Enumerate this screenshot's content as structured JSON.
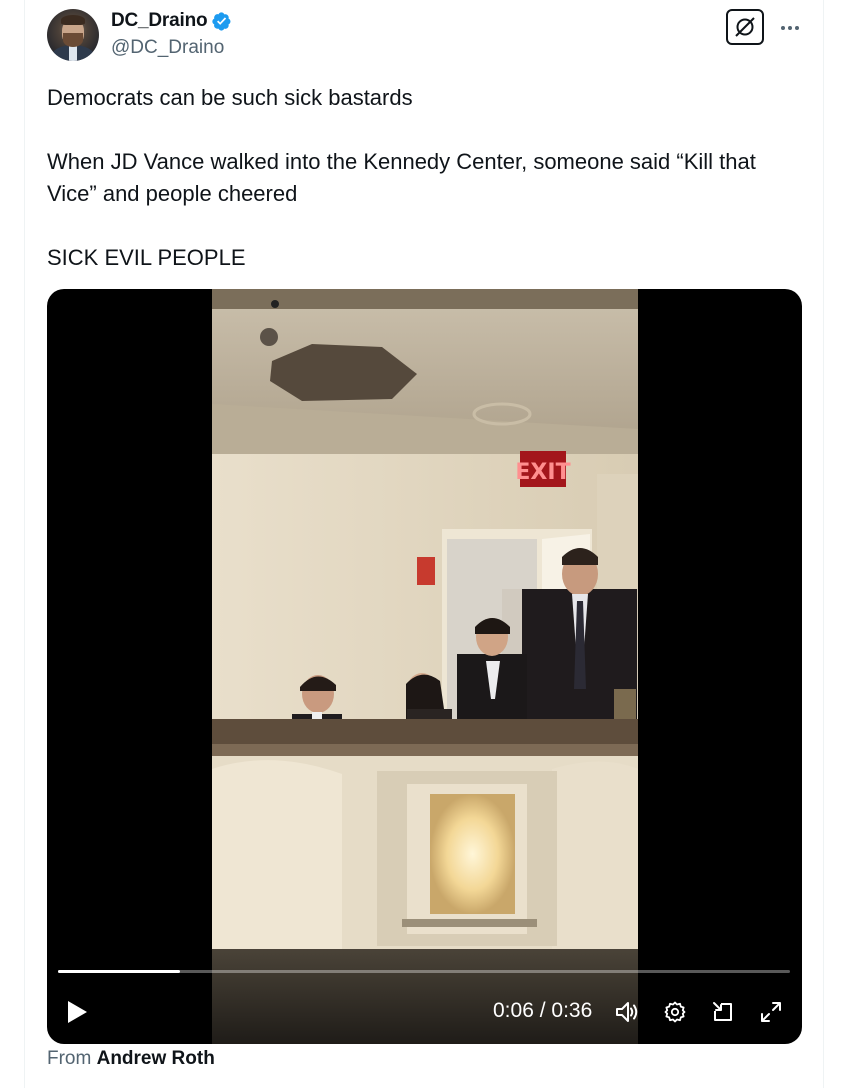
{
  "author": {
    "display_name": "DC_Draino",
    "handle": "@DC_Draino",
    "verified": true
  },
  "header_actions": {
    "grok_icon": "grok-slash-icon",
    "more_icon": "more-dots-icon"
  },
  "tweet": {
    "paragraphs": [
      "Democrats can be such sick bastards",
      "When JD Vance walked into the Kennedy Center, someone said “Kill that Vice” and people cheered",
      "SICK EVIL PEOPLE"
    ]
  },
  "video": {
    "exit_sign": "EXIT",
    "current_time": "0:06",
    "separator": " / ",
    "duration": "0:36",
    "progress_fraction": 0.167,
    "controls": {
      "play_icon": "play-icon",
      "volume_icon": "volume-icon",
      "settings_icon": "gear-icon",
      "pip_icon": "picture-in-picture-icon",
      "fullscreen_icon": "fullscreen-icon"
    }
  },
  "attribution": {
    "prefix": "From",
    "source": "Andrew Roth"
  },
  "colors": {
    "verified_blue": "#1d9bf0",
    "text_primary": "#0f1419",
    "text_secondary": "#536471"
  }
}
